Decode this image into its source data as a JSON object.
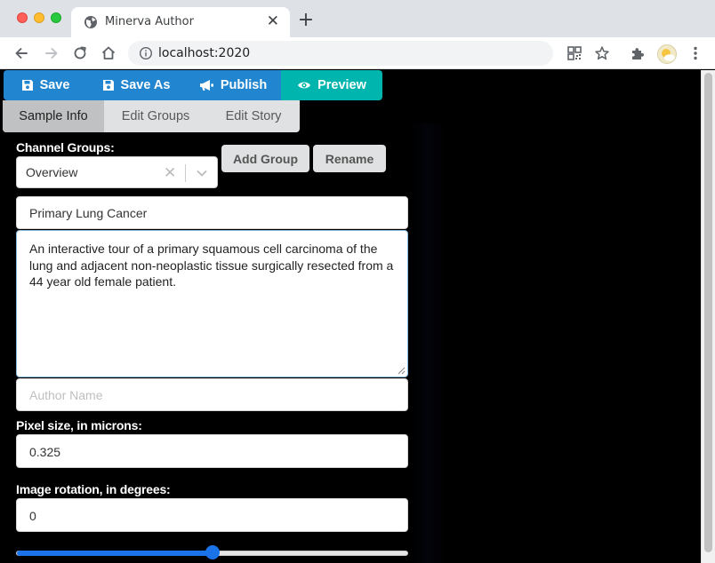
{
  "browser": {
    "tab_title": "Minerva Author",
    "url": "localhost:2020",
    "icons": [
      "globe-icon",
      "back-icon",
      "forward-icon",
      "reload-icon",
      "home-icon",
      "info-icon",
      "qr-icon",
      "star-icon",
      "extensions-icon",
      "menu-icon"
    ]
  },
  "actions": {
    "save": "Save",
    "save_as": "Save As",
    "publish": "Publish",
    "preview": "Preview",
    "colors": {
      "primary": "#2185d0",
      "preview": "#00b5ad"
    }
  },
  "tabs": {
    "items": [
      "Sample Info",
      "Edit Groups",
      "Edit Story"
    ],
    "active": "Sample Info"
  },
  "channel_groups": {
    "label": "Channel Groups:",
    "selected": "Overview",
    "add_group": "Add Group",
    "rename": "Rename"
  },
  "sample": {
    "title": "Primary Lung Cancer",
    "description": "An interactive tour of a primary squamous cell carcinoma of the lung and adjacent non-neoplastic tissue surgically resected from a 44 year old female patient.",
    "author_placeholder": "Author Name",
    "pixel_label": "Pixel size, in microns:",
    "pixel_value": "0.325",
    "rotation_label": "Image rotation, in degrees:",
    "rotation_value": "0",
    "rotation_slider_fraction": 0.5
  }
}
